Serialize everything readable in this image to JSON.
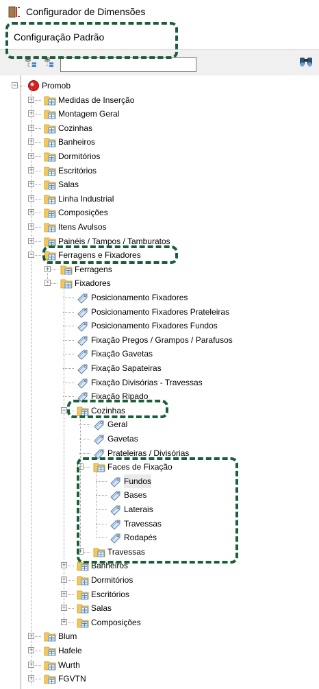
{
  "window": {
    "title": "Configurador de Dimensões",
    "header": "Configuração Padrão"
  },
  "toolbar": {
    "search_value": "",
    "expand_icon": "expand-all-icon",
    "collapse_icon": "collapse-all-icon",
    "find_icon": "binoculars-icon"
  },
  "tree": {
    "root": "Promob",
    "level1": [
      "Medidas de Inserção",
      "Montagem Geral",
      "Cozinhas",
      "Banheiros",
      "Dormitórios",
      "Escritórios",
      "Salas",
      "Linha Industrial",
      "Composições",
      "Itens Avulsos",
      "Painéis / Tampos / Tamburatos",
      "Ferragens e Fixadores"
    ],
    "ferragens": "Ferragens",
    "fixadores": "Fixadores",
    "fixadores_items": [
      "Posicionamento Fixadores",
      "Posicionamento Fixadores Prateleiras",
      "Posicionamento Fixadores Fundos",
      "Fixação Pregos / Grampos / Parafusos",
      "Fixação Gavetas",
      "Fixação Sapateiras",
      "Fixação Divisórias - Travessas",
      "Fixação Ripado"
    ],
    "cozinhas": "Cozinhas",
    "cozinhas_items": [
      "Geral",
      "Gavetas",
      "Prateleiras / Divisórias"
    ],
    "faces": "Faces de Fixação",
    "faces_items": [
      "Fundos",
      "Bases",
      "Laterais",
      "Travessas",
      "Rodapés"
    ],
    "travessas": "Travessas",
    "fix_folders": [
      "Banheiros",
      "Dormitórios",
      "Escritórios",
      "Salas",
      "Composições"
    ],
    "bottom": [
      "Blum",
      "Hafele",
      "Wurth",
      "FGVTN"
    ]
  },
  "colors": {
    "callout": "#1b5e3a",
    "folder": "#f2c85b",
    "folder_dark": "#d8a531",
    "doc_blue": "#4a86c8",
    "toolbar_bg": "#f0f0f0"
  }
}
